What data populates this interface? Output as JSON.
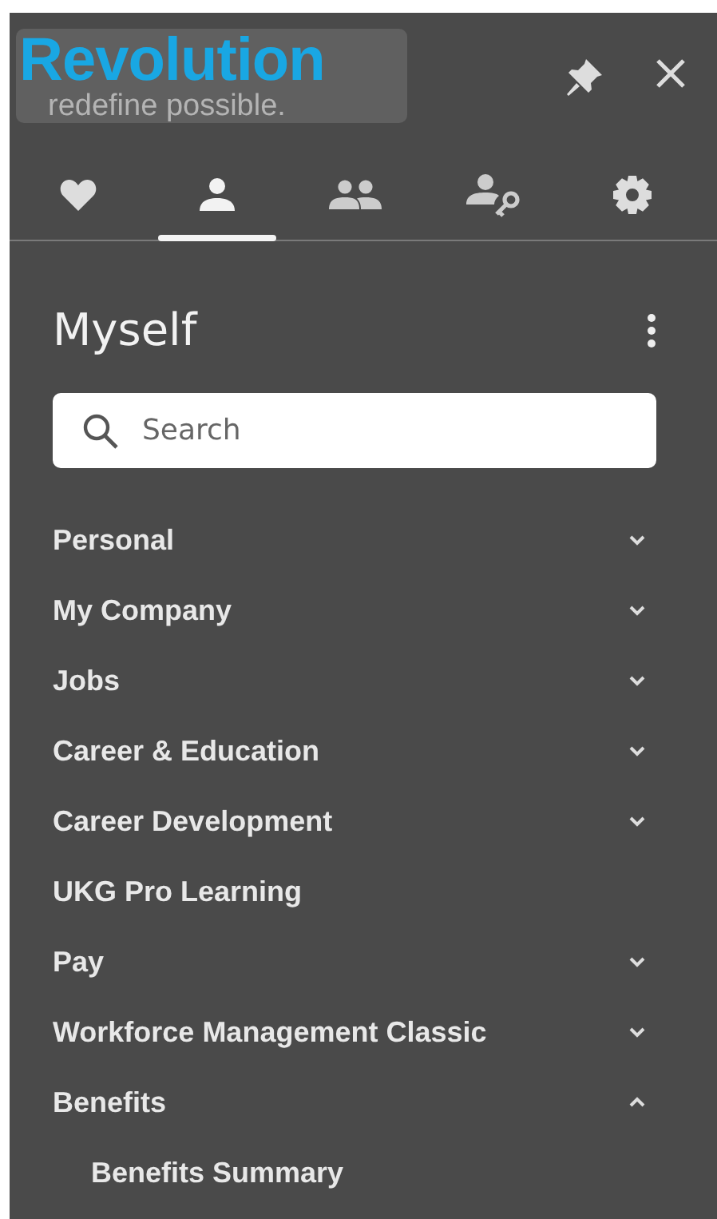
{
  "logo": {
    "name": "Revolution",
    "tagline": "redefine possible."
  },
  "tabs": [
    {
      "kind": "heart",
      "selected": false
    },
    {
      "kind": "person",
      "selected": true
    },
    {
      "kind": "people",
      "selected": false
    },
    {
      "kind": "person-key",
      "selected": false
    },
    {
      "kind": "gear",
      "selected": false
    }
  ],
  "title": "Myself",
  "search": {
    "placeholder": "Search"
  },
  "menu": [
    {
      "label": "Personal",
      "kind": "group",
      "expanded": false
    },
    {
      "label": "My Company",
      "kind": "group",
      "expanded": false
    },
    {
      "label": "Jobs",
      "kind": "group",
      "expanded": false
    },
    {
      "label": "Career & Education",
      "kind": "group",
      "expanded": false
    },
    {
      "label": "Career Development",
      "kind": "group",
      "expanded": false
    },
    {
      "label": "UKG Pro Learning",
      "kind": "link"
    },
    {
      "label": "Pay",
      "kind": "group",
      "expanded": false
    },
    {
      "label": "Workforce Management Classic",
      "kind": "group",
      "expanded": false
    },
    {
      "label": "Benefits",
      "kind": "group",
      "expanded": true,
      "children": [
        {
          "label": "Benefits Summary"
        }
      ]
    }
  ]
}
